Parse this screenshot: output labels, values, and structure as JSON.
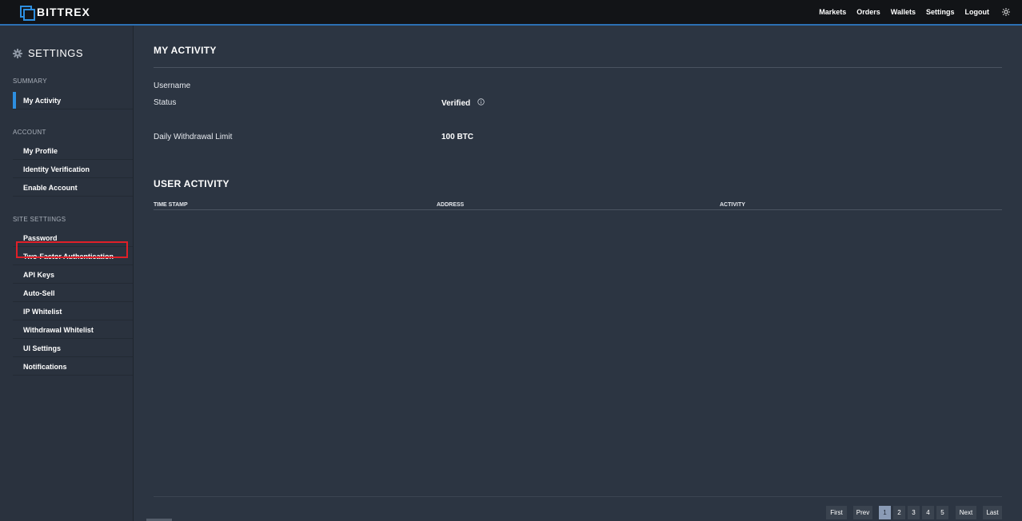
{
  "brand": {
    "name": "BITTREX"
  },
  "topnav": {
    "items": [
      "Markets",
      "Orders",
      "Wallets",
      "Settings",
      "Logout"
    ],
    "theme_icon": "sun-icon"
  },
  "sidebar": {
    "title": "SETTINGS",
    "title_icon": "gear-icon",
    "sections": [
      {
        "heading": "SUMMARY",
        "items": [
          "My Activity"
        ]
      },
      {
        "heading": "ACCOUNT",
        "items": [
          "My Profile",
          "Identity Verification",
          "Enable Account"
        ]
      },
      {
        "heading": "SITE SETTIINGS",
        "items": [
          "Password",
          "Two-Factor Authentication",
          "API Keys",
          "Auto-Sell",
          "IP Whitelist",
          "Withdrawal Whitelist",
          "UI Settings",
          "Notifications"
        ]
      }
    ],
    "active_item": "My Activity",
    "highlighted_item": "API Keys"
  },
  "main": {
    "title": "MY ACTIVITY",
    "fields": [
      {
        "label": "Username",
        "value": ""
      },
      {
        "label": "Status",
        "value": "Verified",
        "icon": "info-icon"
      },
      {
        "label": "Daily Withdrawal Limit",
        "value": "100 BTC"
      }
    ],
    "activity": {
      "title": "USER ACTIVITY",
      "columns": [
        "TIME STAMP",
        "ADDRESS",
        "ACTIVITY"
      ],
      "rows": []
    },
    "pagination": {
      "first": "First",
      "prev": "Prev",
      "pages": [
        "1",
        "2",
        "3",
        "4",
        "5"
      ],
      "current": "1",
      "next": "Next",
      "last": "Last"
    }
  },
  "colors": {
    "accent": "#2d8fe0",
    "background": "#2c3542",
    "topbar": "#121417",
    "highlight_border": "#e01f28"
  }
}
